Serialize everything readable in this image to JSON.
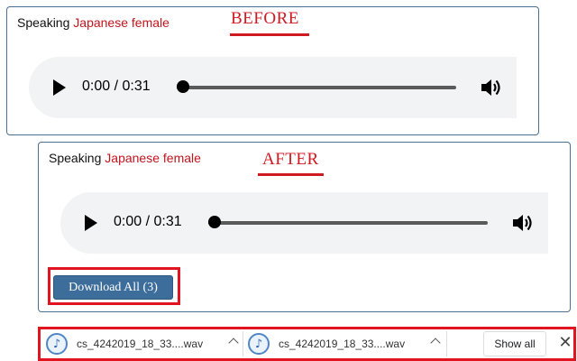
{
  "before_panel": {
    "speaking_label": "Speaking",
    "voice_label": "Japanese female",
    "tag": "BEFORE",
    "player": {
      "time": "0:00 / 0:31"
    }
  },
  "after_panel": {
    "speaking_label": "Speaking",
    "voice_label": "Japanese female",
    "tag": "AFTER",
    "player": {
      "time": "0:00 / 0:31"
    },
    "download_button_label": "Download All (3)"
  },
  "download_shelf": {
    "items": [
      {
        "file_name": "cs_4242019_18_33....wav",
        "icon": "audio-file-icon"
      },
      {
        "file_name": "cs_4242019_18_33....wav",
        "icon": "audio-file-icon"
      }
    ],
    "show_all_label": "Show all",
    "close_label": "✕"
  },
  "colors": {
    "accent_red": "#d01a22",
    "button_blue": "#3d6d9b",
    "panel_border": "#4a6f93",
    "player_bg": "#f1f3f4"
  }
}
